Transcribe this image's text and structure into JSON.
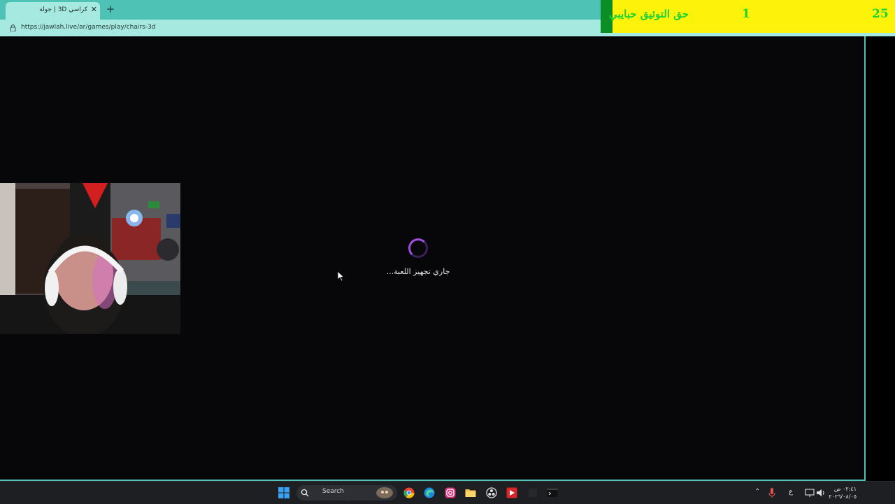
{
  "browser": {
    "tab_title": "كراسي 3D | جولة",
    "tab_close": "✕",
    "new_tab": "+",
    "url": "https://jawlah.live/ar/games/play/chairs-3d"
  },
  "overlay": {
    "label": "حق التوثيق حبايبي",
    "count": "1",
    "score": "25"
  },
  "game": {
    "loading_text": "جاري تجهيز اللعبة..."
  },
  "taskbar": {
    "search_label": "Search",
    "tray_lang": "ع",
    "time": "٠٢:٤١ ص",
    "date": "٢٠٢٦/٠٨/٠٥"
  },
  "colors": {
    "chrome": "#4ec2b5",
    "chrome_light": "#a5e9e0",
    "overlay_bg": "#fcf20a",
    "overlay_text": "#1bd334",
    "spinner": "#a64be2"
  }
}
